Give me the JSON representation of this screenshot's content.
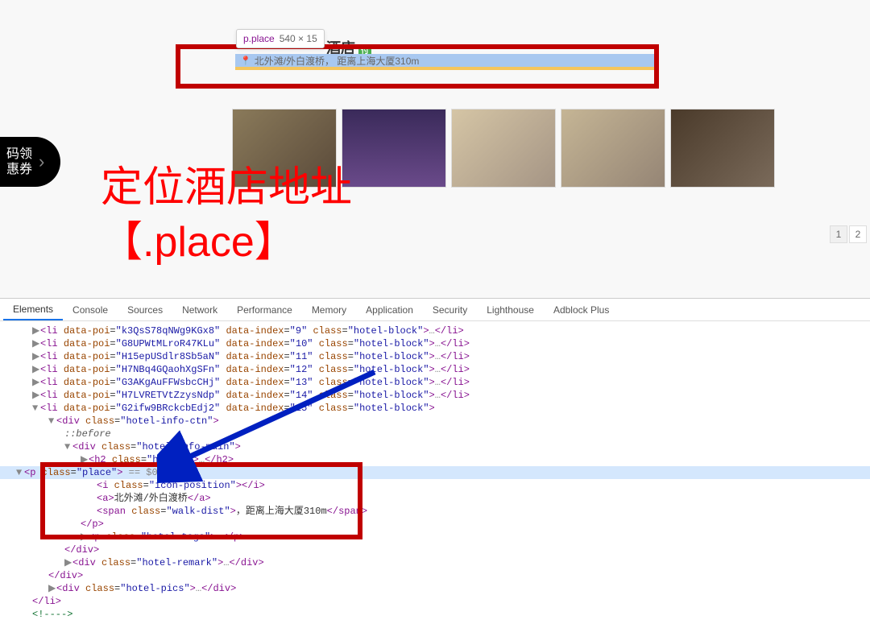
{
  "promo": {
    "line1": "码领",
    "line2": "惠券"
  },
  "tooltip": {
    "selector": "p.place",
    "dims": "540 × 15"
  },
  "hotel": {
    "title_partial": "酒店",
    "place_text": "北外滩/外白渡桥， 距离上海大厦310m"
  },
  "annotation": {
    "line1": "定位酒店地址",
    "line2": "【.place】"
  },
  "pagination": {
    "pages": [
      "1",
      "2"
    ]
  },
  "devtools": {
    "tabs": [
      "Elements",
      "Console",
      "Sources",
      "Network",
      "Performance",
      "Memory",
      "Application",
      "Security",
      "Lighthouse",
      "Adblock Plus"
    ],
    "active_tab": 0,
    "dom": {
      "li_items": [
        {
          "poi": "k3QsS78qNWg9KGx8",
          "index": "9",
          "class": "hotel-block"
        },
        {
          "poi": "G8UPWtMLroR47KLu",
          "index": "10",
          "class": "hotel-block"
        },
        {
          "poi": "H15epUSdlr8Sb5aN",
          "index": "11",
          "class": "hotel-block"
        },
        {
          "poi": "H7NBq4GQaohXgSFn",
          "index": "12",
          "class": "hotel-block"
        },
        {
          "poi": "G3AKgAuFFWsbcCHj",
          "index": "13",
          "class": "hotel-block"
        },
        {
          "poi": "H7LVRETVtZzysNdp",
          "index": "14",
          "class": "hotel-block"
        },
        {
          "poi": "G2ifw9BRckcbEdj2",
          "index": "15",
          "class": "hotel-block"
        }
      ],
      "div_info_ctn": "hotel-info-ctn",
      "pseudo": "::before",
      "div_info_main": "hotel-info-main",
      "h2_class": "hotel-",
      "p_class": "place",
      "p_equals": "== $0",
      "i_class": "icon-position",
      "a_text": "北外滩/外白渡桥",
      "span_class": "walk-dist",
      "span_text": "，距离上海大厦310m",
      "p_tags": "hotel-tags",
      "div_remark": "hotel-remark",
      "div_pics": "hotel-pics"
    }
  }
}
